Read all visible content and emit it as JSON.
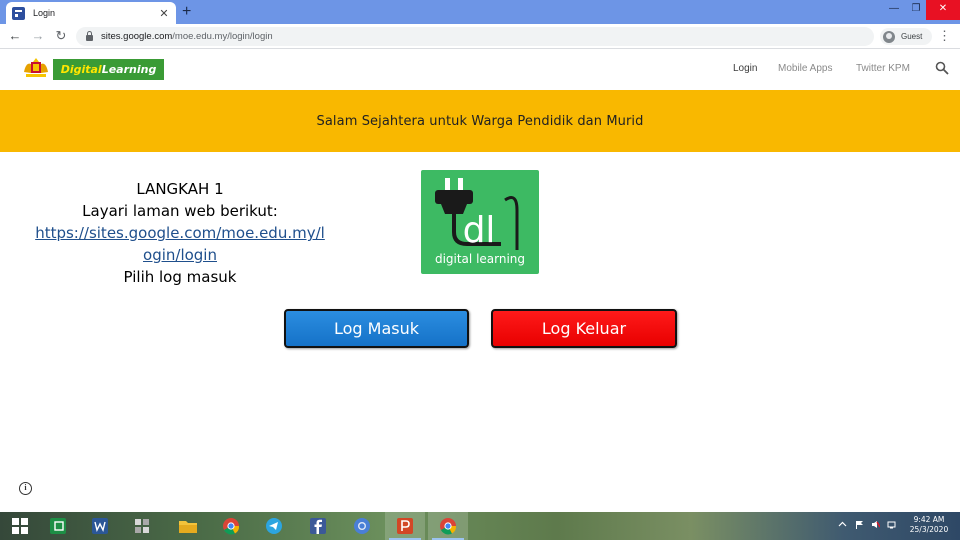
{
  "browser": {
    "tab_title": "Login",
    "tab_close": "✕",
    "new_tab": "+",
    "window_controls": {
      "minimize": "—",
      "maximize": "❐",
      "close": "✕"
    },
    "nav": {
      "back": "←",
      "forward": "→",
      "reload": "↻"
    },
    "url_host": "sites.google.com",
    "url_path": "/moe.edu.my/login/login",
    "profile_label": "Guest",
    "menu": "⋮"
  },
  "site": {
    "brand_part1": "Digital",
    "brand_part2": " Learning",
    "nav": [
      "Login",
      "Mobile Apps",
      "Twitter KPM"
    ],
    "banner": "Salam Sejahtera untuk Warga Pendidik dan Murid"
  },
  "steps": {
    "heading": "LANGKAH 1",
    "line1": "Layari laman web berikut:",
    "link_part1": "https://sites.google.com/moe.edu.my/l",
    "link_part2": "ogin/login",
    "line3": "Pilih log masuk"
  },
  "logo": {
    "letters": "dl",
    "caption": "digital learning"
  },
  "buttons": {
    "login": "Log Masuk",
    "logout": "Log Keluar"
  },
  "info": "i",
  "taskbar": {
    "apps": [
      "windows",
      "excel",
      "word",
      "files-grid",
      "file-explorer",
      "chrome",
      "telegram",
      "facebook",
      "chrome-alt",
      "powerpoint",
      "chrome-active"
    ],
    "time": "9:42 AM",
    "date": "25/3/2020"
  }
}
